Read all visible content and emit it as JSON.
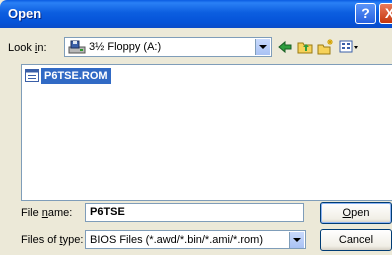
{
  "window": {
    "title": "Open"
  },
  "titlebar": {
    "help_glyph": "?",
    "close_glyph": "X"
  },
  "lookin": {
    "label_pre": "Look ",
    "label_accel": "i",
    "label_post": "n:",
    "value": "3½ Floppy (A:)",
    "icon": "floppy-drive-icon"
  },
  "toolbar": {
    "icons": [
      "back-arrow-icon",
      "up-folder-icon",
      "new-folder-icon",
      "view-menu-icon"
    ]
  },
  "files": [
    {
      "name": "P6TSE.ROM",
      "icon": "file-icon",
      "selected": true
    }
  ],
  "filename": {
    "label_pre": "File ",
    "label_accel": "n",
    "label_post": "ame:",
    "value": "P6TSE"
  },
  "filetype": {
    "label_pre": "Files of ",
    "label_accel": "t",
    "label_post": "ype:",
    "value": "BIOS Files (*.awd/*.bin/*.ami/*.rom)"
  },
  "buttons": {
    "open_accel": "O",
    "open_rest": "pen",
    "cancel": "Cancel"
  },
  "colors": {
    "titlebar": "#0553d8",
    "selection": "#316ac5",
    "dialog_bg": "#ece9d8"
  }
}
